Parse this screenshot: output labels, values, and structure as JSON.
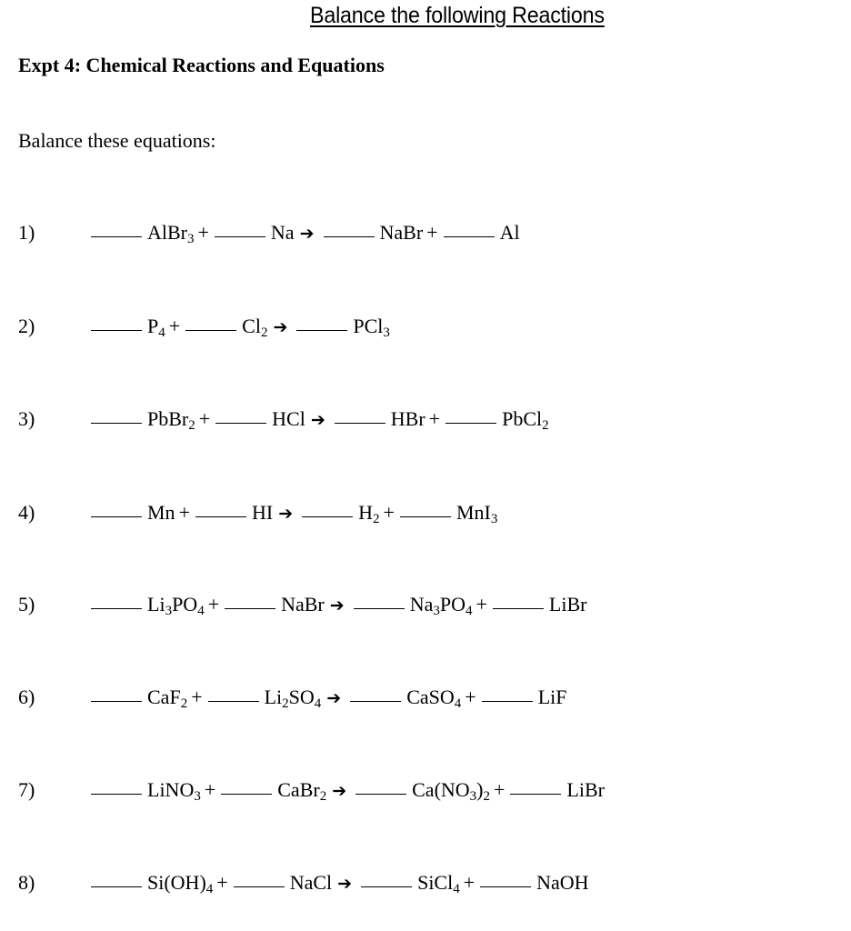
{
  "header": {
    "title": "Balance the following Reactions",
    "experiment_heading": "Expt 4: Chemical Reactions and Equations",
    "instruction": "Balance these equations:"
  },
  "symbols": {
    "plus": "+",
    "arrow": "➔"
  },
  "equations": [
    {
      "number": "1)",
      "reactants": [
        {
          "coefficient": "",
          "formula": [
            [
              "AlBr",
              ""
            ],
            [
              "3",
              "sub"
            ]
          ]
        },
        {
          "coefficient": "",
          "formula": [
            [
              "Na",
              ""
            ]
          ]
        }
      ],
      "products": [
        {
          "coefficient": "",
          "formula": [
            [
              "NaBr",
              ""
            ]
          ]
        },
        {
          "coefficient": "",
          "formula": [
            [
              "Al",
              ""
            ]
          ]
        }
      ]
    },
    {
      "number": "2)",
      "reactants": [
        {
          "coefficient": "",
          "formula": [
            [
              "P",
              ""
            ],
            [
              "4",
              "sub"
            ]
          ]
        },
        {
          "coefficient": "",
          "formula": [
            [
              "Cl",
              ""
            ],
            [
              "2",
              "sub"
            ]
          ]
        }
      ],
      "products": [
        {
          "coefficient": "",
          "formula": [
            [
              "PCl",
              ""
            ],
            [
              "3",
              "sub"
            ]
          ]
        }
      ]
    },
    {
      "number": "3)",
      "reactants": [
        {
          "coefficient": "",
          "formula": [
            [
              "PbBr",
              ""
            ],
            [
              "2",
              "sub"
            ]
          ]
        },
        {
          "coefficient": "",
          "formula": [
            [
              "HCl",
              ""
            ]
          ]
        }
      ],
      "products": [
        {
          "coefficient": "",
          "formula": [
            [
              "HBr",
              ""
            ]
          ]
        },
        {
          "coefficient": "",
          "formula": [
            [
              "PbCl",
              ""
            ],
            [
              "2",
              "sub"
            ]
          ]
        }
      ]
    },
    {
      "number": "4)",
      "reactants": [
        {
          "coefficient": "",
          "formula": [
            [
              "Mn",
              ""
            ]
          ]
        },
        {
          "coefficient": "",
          "formula": [
            [
              "HI",
              ""
            ]
          ]
        }
      ],
      "products": [
        {
          "coefficient": "",
          "formula": [
            [
              "H",
              ""
            ],
            [
              "2",
              "sub"
            ]
          ]
        },
        {
          "coefficient": "",
          "formula": [
            [
              "MnI",
              ""
            ],
            [
              "3",
              "sub"
            ]
          ]
        }
      ]
    },
    {
      "number": "5)",
      "reactants": [
        {
          "coefficient": "",
          "formula": [
            [
              "Li",
              ""
            ],
            [
              "3",
              "sub"
            ],
            [
              "PO",
              ""
            ],
            [
              "4",
              "sub"
            ]
          ]
        },
        {
          "coefficient": "",
          "formula": [
            [
              "NaBr",
              ""
            ]
          ]
        }
      ],
      "products": [
        {
          "coefficient": "",
          "formula": [
            [
              "Na",
              ""
            ],
            [
              "3",
              "sub"
            ],
            [
              "PO",
              ""
            ],
            [
              "4",
              "sub"
            ]
          ]
        },
        {
          "coefficient": "",
          "formula": [
            [
              "LiBr",
              ""
            ]
          ]
        }
      ]
    },
    {
      "number": "6)",
      "reactants": [
        {
          "coefficient": "",
          "formula": [
            [
              "CaF",
              ""
            ],
            [
              "2",
              "sub"
            ]
          ]
        },
        {
          "coefficient": "",
          "formula": [
            [
              "Li",
              ""
            ],
            [
              "2",
              "sub"
            ],
            [
              "SO",
              ""
            ],
            [
              "4",
              "sub"
            ]
          ]
        }
      ],
      "products": [
        {
          "coefficient": "",
          "formula": [
            [
              "CaSO",
              ""
            ],
            [
              "4",
              "sub"
            ]
          ]
        },
        {
          "coefficient": "",
          "formula": [
            [
              "LiF",
              ""
            ]
          ]
        }
      ]
    },
    {
      "number": "7)",
      "reactants": [
        {
          "coefficient": "",
          "formula": [
            [
              "LiNO",
              ""
            ],
            [
              "3",
              "sub"
            ]
          ]
        },
        {
          "coefficient": "",
          "formula": [
            [
              "CaBr",
              ""
            ],
            [
              "2",
              "sub"
            ]
          ]
        }
      ],
      "products": [
        {
          "coefficient": "",
          "formula": [
            [
              "Ca(NO",
              ""
            ],
            [
              "3",
              "sub"
            ],
            [
              ")",
              ""
            ],
            [
              "2",
              "sub"
            ]
          ]
        },
        {
          "coefficient": "",
          "formula": [
            [
              "LiBr",
              ""
            ]
          ]
        }
      ]
    },
    {
      "number": "8)",
      "reactants": [
        {
          "coefficient": "",
          "formula": [
            [
              "Si(OH)",
              ""
            ],
            [
              "4",
              "sub"
            ]
          ]
        },
        {
          "coefficient": "",
          "formula": [
            [
              "NaCl",
              ""
            ]
          ]
        }
      ],
      "products": [
        {
          "coefficient": "",
          "formula": [
            [
              "SiCl",
              ""
            ],
            [
              "4",
              "sub"
            ]
          ]
        },
        {
          "coefficient": "",
          "formula": [
            [
              "NaOH",
              ""
            ]
          ]
        }
      ]
    }
  ]
}
